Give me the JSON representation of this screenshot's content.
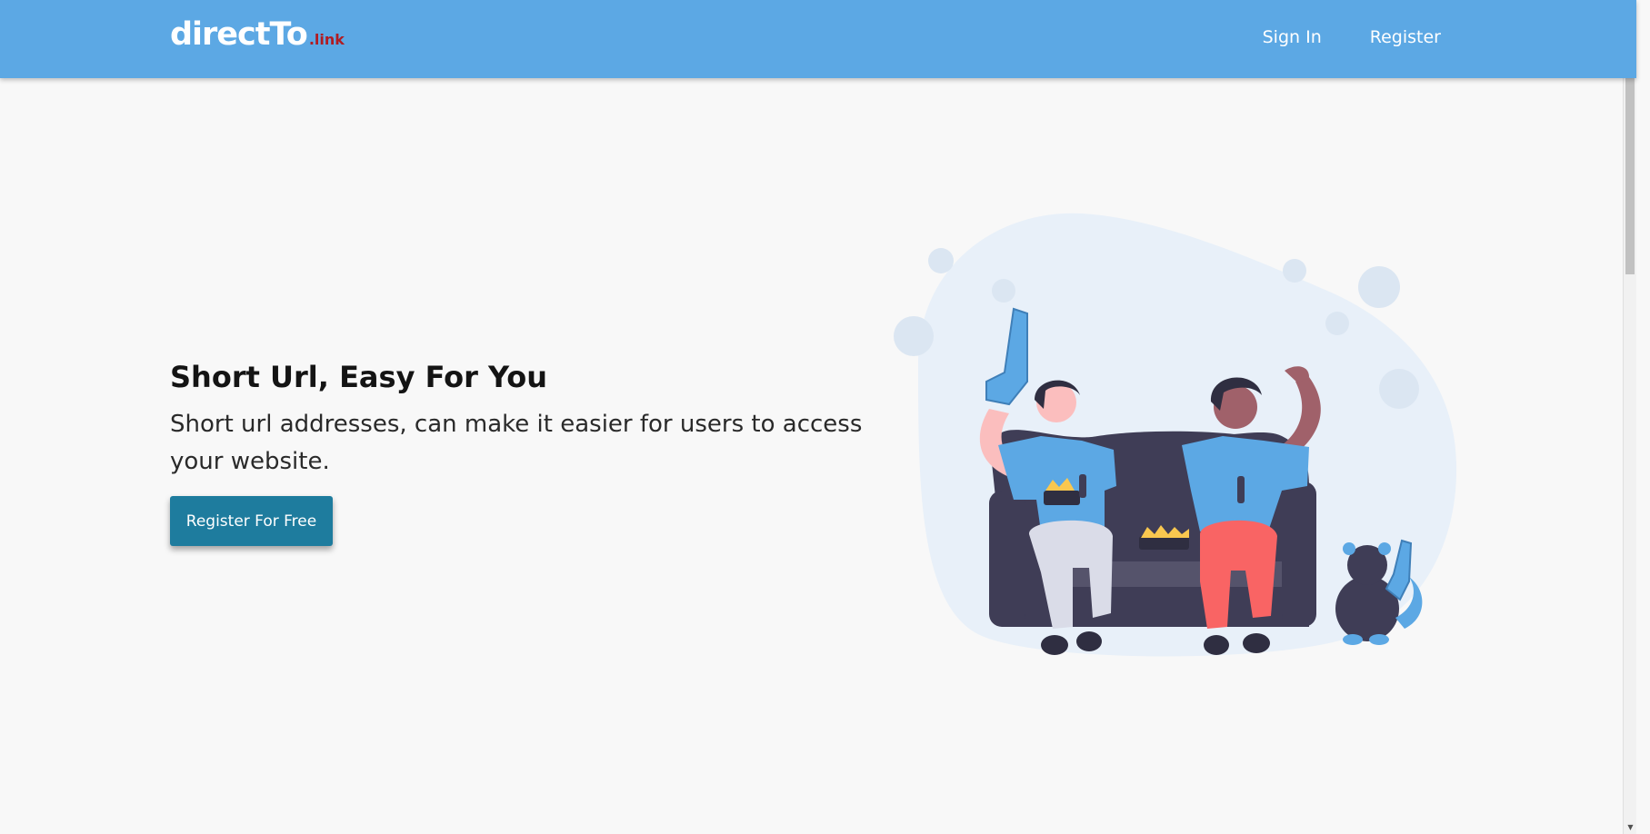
{
  "navbar": {
    "logo_main": "directTo",
    "logo_tld": ".link",
    "sign_in": "Sign In",
    "register": "Register"
  },
  "hero": {
    "title": "Short Url, Easy For You",
    "subtitle": "Short url addresses, can make it easier for users to access your website.",
    "cta_label": "Register For Free"
  },
  "colors": {
    "navbar": "#5ca8e4",
    "cta": "#1e7c9e",
    "logo_tld": "#b01c22",
    "background": "#f8f8f8"
  },
  "icons": {
    "illustration": "friends-watching-sports-on-couch",
    "scroll_up": "arrow-up-icon",
    "scroll_down": "arrow-down-icon"
  }
}
